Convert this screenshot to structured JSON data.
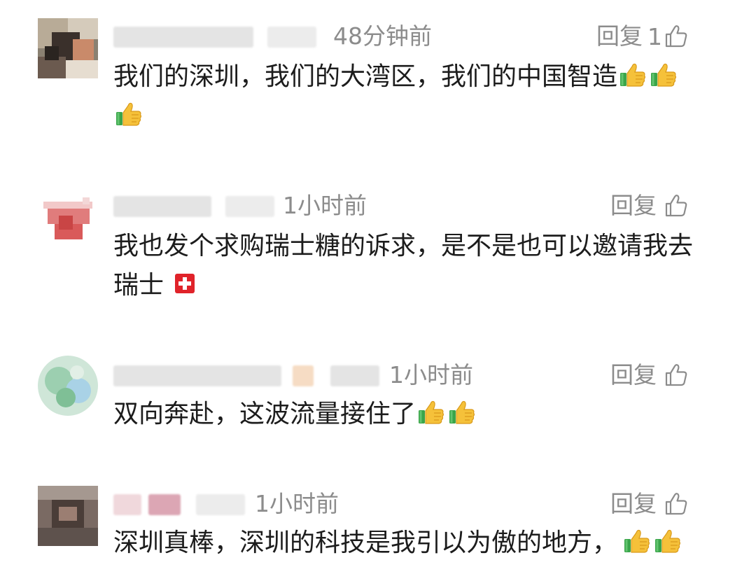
{
  "comments": [
    {
      "time": "48分钟前",
      "reply_label": "回复",
      "like_count": "1",
      "text": "我们的深圳，我们的大湾区，我们的中国智造",
      "emojis_after": [
        "thumbs-up",
        "thumbs-up",
        "thumbs-up"
      ]
    },
    {
      "time": "1小时前",
      "reply_label": "回复",
      "like_count": "",
      "text": "我也发个求购瑞士糖的诉求，是不是也可以邀请我去瑞士",
      "emojis_after": [
        "swiss-flag"
      ]
    },
    {
      "time": "1小时前",
      "reply_label": "回复",
      "like_count": "",
      "text": "双向奔赴，这波流量接住了",
      "emojis_after": [
        "thumbs-up",
        "thumbs-up"
      ]
    },
    {
      "time": "1小时前",
      "reply_label": "回复",
      "like_count": "",
      "text": "深圳真棒，深圳的科技是我引以为傲的地方，",
      "emojis_after": [
        "thumbs-up",
        "thumbs-up"
      ]
    }
  ],
  "colors": {
    "meta_text": "#8c8c8c",
    "body_text": "#1c1c1c"
  }
}
